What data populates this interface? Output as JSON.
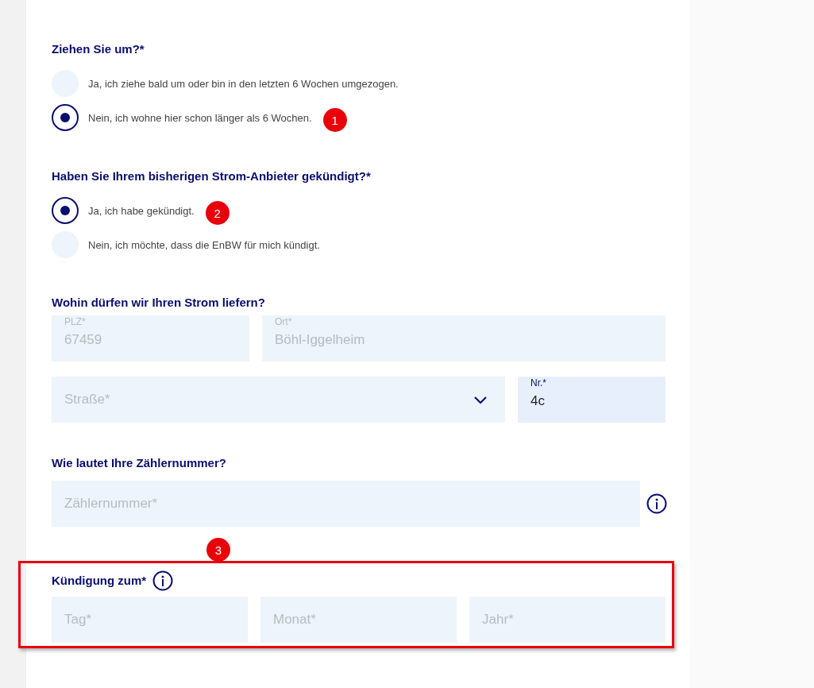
{
  "moving": {
    "title": "Ziehen Sie um?*",
    "options": [
      {
        "label": "Ja, ich ziehe bald um oder bin in den letzten 6 Wochen umgezogen.",
        "selected": false
      },
      {
        "label": "Nein, ich wohne hier schon länger als 6 Wochen.",
        "selected": true,
        "badge": "1"
      }
    ]
  },
  "cancelled": {
    "title": "Haben Sie Ihrem bisherigen Strom-Anbieter gekündigt?*",
    "options": [
      {
        "label": "Ja, ich habe gekündigt.",
        "selected": true,
        "badge": "2"
      },
      {
        "label": "Nein, ich möchte, dass die EnBW für mich kündigt.",
        "selected": false
      }
    ]
  },
  "address": {
    "title": "Wohin dürfen wir Ihren Strom liefern?",
    "postcode": {
      "label": "PLZ*",
      "value": "67459",
      "disabled": true
    },
    "city": {
      "label": "Ort*",
      "value": "Böhl-Iggelheim",
      "disabled": true
    },
    "street": {
      "placeholder": "Straße*"
    },
    "number": {
      "label": "Nr.*",
      "value": "4c",
      "disabled": false
    }
  },
  "meter": {
    "title": "Wie lautet Ihre Zählernummer?",
    "placeholder": "Zählernummer*"
  },
  "termination": {
    "title": "Kündigung zum*",
    "badge": "3",
    "highlighted": true,
    "fields": [
      {
        "placeholder": "Tag*"
      },
      {
        "placeholder": "Monat*"
      },
      {
        "placeholder": "Jahr*"
      }
    ]
  }
}
